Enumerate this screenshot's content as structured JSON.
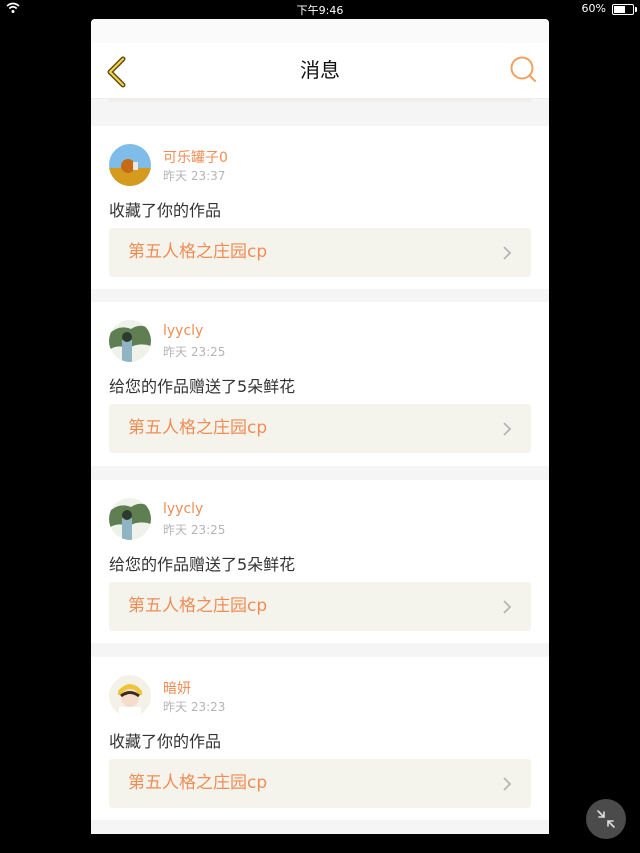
{
  "status_bar": {
    "time": "下午9:46",
    "battery": "60%"
  },
  "header": {
    "title": "消息"
  },
  "colors": {
    "accent": "#ef8d56",
    "link_bg": "#f5f4ec"
  },
  "notifications": [
    {
      "user": "可乐罐子0",
      "time": "昨天 23:37",
      "action": "收藏了你的作品",
      "work": "第五人格之庄园cp",
      "avatar": "sunflower-avatar"
    },
    {
      "user": "lyycly",
      "time": "昨天 23:25",
      "action": "给您的作品赠送了5朵鲜花",
      "work": "第五人格之庄园cp",
      "avatar": "illustration-avatar"
    },
    {
      "user": "lyycly",
      "time": "昨天 23:25",
      "action": "给您的作品赠送了5朵鲜花",
      "work": "第五人格之庄园cp",
      "avatar": "illustration-avatar"
    },
    {
      "user": "暗妍",
      "time": "昨天 23:23",
      "action": "收藏了你的作品",
      "work": "第五人格之庄园cp",
      "avatar": "girl-avatar"
    }
  ]
}
